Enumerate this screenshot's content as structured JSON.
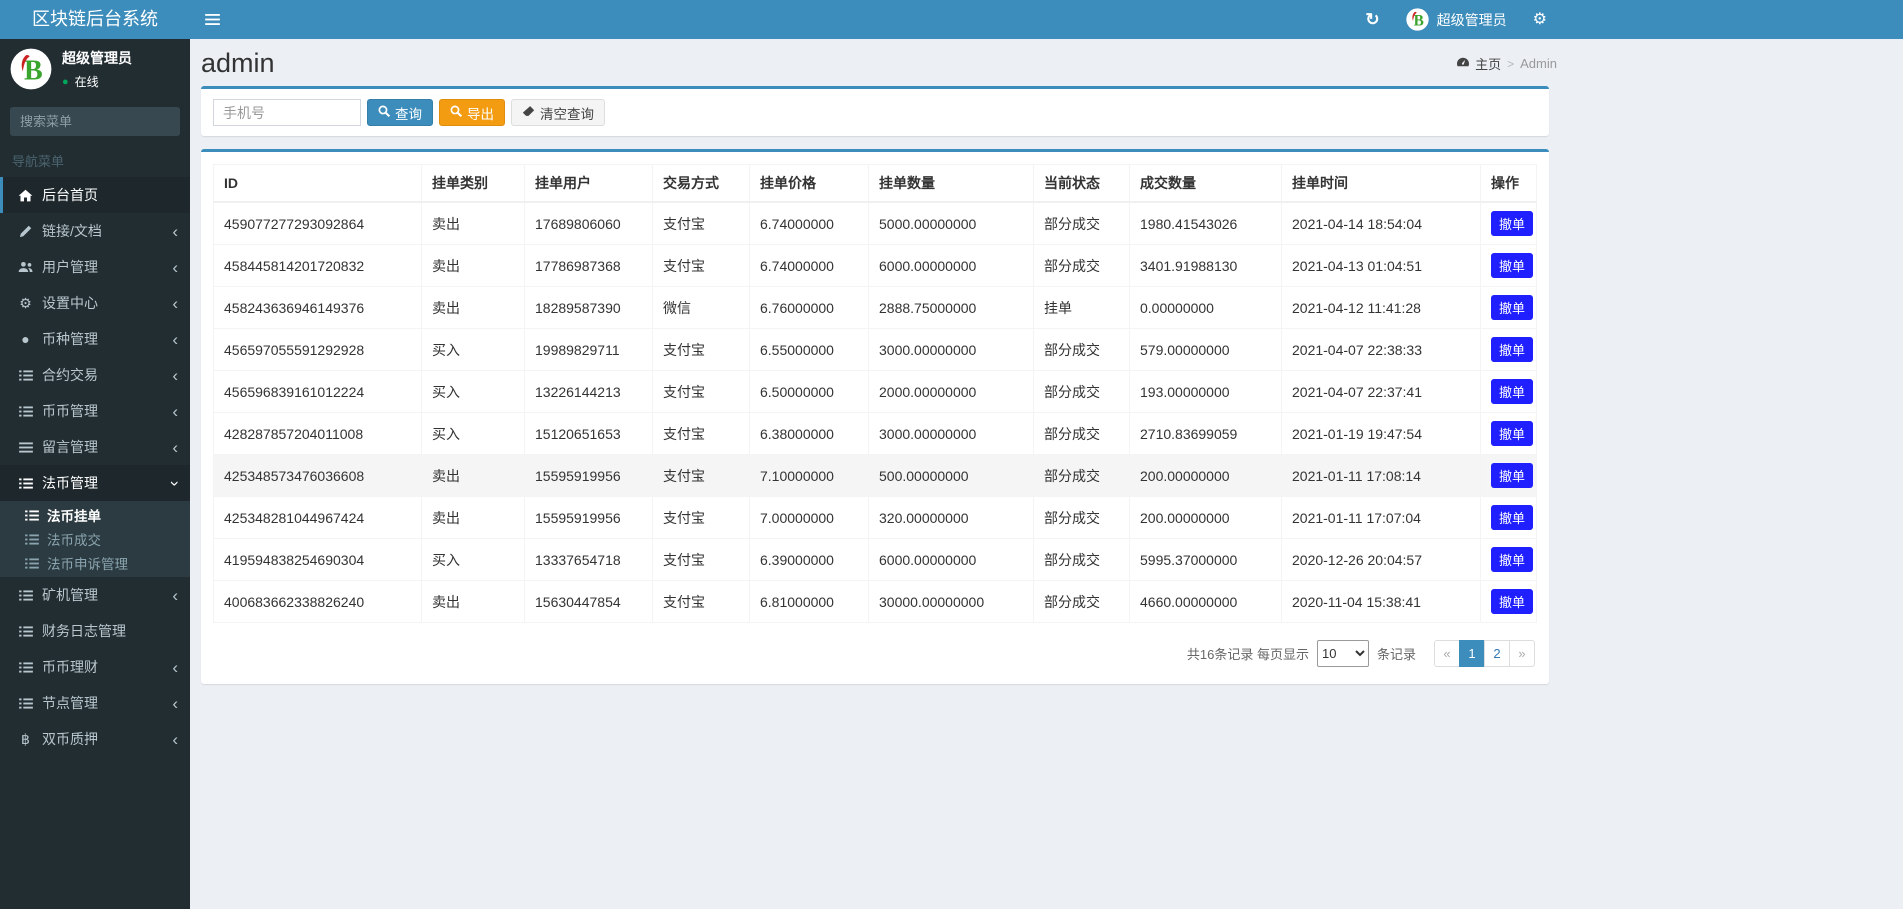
{
  "navbar": {
    "brand": "区块链后台系统",
    "user_name": "超级管理员"
  },
  "sidebar": {
    "user": {
      "name": "超级管理员",
      "status": "在线"
    },
    "search_placeholder": "搜索菜单",
    "nav_header": "导航菜单",
    "items": [
      {
        "key": "home",
        "label": "后台首页",
        "icon": "home",
        "active": true
      },
      {
        "key": "links-docs",
        "label": "链接/文档",
        "icon": "pencil",
        "chevron": true
      },
      {
        "key": "user-mgmt",
        "label": "用户管理",
        "icon": "users",
        "chevron": true
      },
      {
        "key": "settings-center",
        "label": "设置中心",
        "icon": "gears",
        "chevron": true
      },
      {
        "key": "coin-type-mgmt",
        "label": "币种管理",
        "icon": "circle",
        "chevron": true
      },
      {
        "key": "contract-trade",
        "label": "合约交易",
        "icon": "list",
        "chevron": true
      },
      {
        "key": "coin-coin-mgmt",
        "label": "币币管理",
        "icon": "list",
        "chevron": true
      },
      {
        "key": "message-mgmt",
        "label": "留言管理",
        "icon": "align",
        "chevron": true
      },
      {
        "key": "fiat-mgmt",
        "label": "法币管理",
        "icon": "list",
        "open": true,
        "children": [
          {
            "key": "fiat-orders",
            "label": "法币挂单",
            "icon": "list",
            "active": true
          },
          {
            "key": "fiat-deals",
            "label": "法币成交",
            "icon": "list"
          },
          {
            "key": "fiat-appeals",
            "label": "法币申诉管理",
            "icon": "list"
          }
        ]
      },
      {
        "key": "miner-mgmt",
        "label": "矿机管理",
        "icon": "list",
        "chevron": true
      },
      {
        "key": "finance-log-mgmt",
        "label": "财务日志管理",
        "icon": "list"
      },
      {
        "key": "coin-finance",
        "label": "币币理财",
        "icon": "list",
        "chevron": true
      },
      {
        "key": "node-mgmt",
        "label": "节点管理",
        "icon": "list",
        "chevron": true
      },
      {
        "key": "dual-coin-pledge",
        "label": "双币质押",
        "icon": "bitcoin",
        "chevron": true
      }
    ]
  },
  "content": {
    "title": "admin",
    "breadcrumb": {
      "home": "主页",
      "separator": ">",
      "current": "Admin"
    },
    "filter": {
      "phone_placeholder": "手机号",
      "search_label": "查询",
      "export_label": "导出",
      "clear_label": "清空查询"
    },
    "table": {
      "columns": [
        "ID",
        "挂单类别",
        "挂单用户",
        "交易方式",
        "挂单价格",
        "挂单数量",
        "当前状态",
        "成交数量",
        "挂单时间",
        "操作"
      ],
      "action_label": "撤单",
      "hover_row_index": 6,
      "rows": [
        [
          "459077277293092864",
          "卖出",
          "17689806060",
          "支付宝",
          "6.74000000",
          "5000.00000000",
          "部分成交",
          "1980.41543026",
          "2021-04-14 18:54:04"
        ],
        [
          "458445814201720832",
          "卖出",
          "17786987368",
          "支付宝",
          "6.74000000",
          "6000.00000000",
          "部分成交",
          "3401.91988130",
          "2021-04-13 01:04:51"
        ],
        [
          "458243636946149376",
          "卖出",
          "18289587390",
          "微信",
          "6.76000000",
          "2888.75000000",
          "挂单",
          "0.00000000",
          "2021-04-12 11:41:28"
        ],
        [
          "456597055591292928",
          "买入",
          "19989829711",
          "支付宝",
          "6.55000000",
          "3000.00000000",
          "部分成交",
          "579.00000000",
          "2021-04-07 22:38:33"
        ],
        [
          "456596839161012224",
          "买入",
          "13226144213",
          "支付宝",
          "6.50000000",
          "2000.00000000",
          "部分成交",
          "193.00000000",
          "2021-04-07 22:37:41"
        ],
        [
          "428287857204011008",
          "买入",
          "15120651653",
          "支付宝",
          "6.38000000",
          "3000.00000000",
          "部分成交",
          "2710.83699059",
          "2021-01-19 19:47:54"
        ],
        [
          "425348573476036608",
          "卖出",
          "15595919956",
          "支付宝",
          "7.10000000",
          "500.00000000",
          "部分成交",
          "200.00000000",
          "2021-01-11 17:08:14"
        ],
        [
          "425348281044967424",
          "卖出",
          "15595919956",
          "支付宝",
          "7.00000000",
          "320.00000000",
          "部分成交",
          "200.00000000",
          "2021-01-11 17:07:04"
        ],
        [
          "419594838254690304",
          "买入",
          "13337654718",
          "支付宝",
          "6.39000000",
          "6000.00000000",
          "部分成交",
          "5995.37000000",
          "2020-12-26 20:04:57"
        ],
        [
          "400683662338826240",
          "卖出",
          "15630447854",
          "支付宝",
          "6.81000000",
          "30000.00000000",
          "部分成交",
          "4660.00000000",
          "2020-11-04 15:38:41"
        ]
      ]
    },
    "pagination": {
      "total_text": "共16条记录 每页显示",
      "per_page": "10",
      "suffix": "条记录",
      "pages": [
        {
          "key": "prev",
          "label": "«",
          "disabled": true
        },
        {
          "key": "page-1",
          "label": "1",
          "active": true
        },
        {
          "key": "page-2",
          "label": "2"
        },
        {
          "key": "next",
          "label": "»",
          "disabled": true
        }
      ]
    }
  },
  "icon_glyphs": {
    "refresh": "↻",
    "gears": "⚙",
    "circle": "●",
    "bitcoin": "฿",
    "chevron-left": "‹",
    "status-dot": "●"
  },
  "colors": {
    "navbar": "#3c8dbc",
    "sidebar": "#222d32",
    "sidebar_active_bg": "#1e282c",
    "submenu_bg": "#2c3b41",
    "box_accent": "#3c8dbc",
    "primary_button": "#3c8dbc",
    "warning_button": "#f39c12",
    "action_button": "#1f1fff",
    "online_green": "#00a65a",
    "content_bg": "#ecf0f5"
  }
}
